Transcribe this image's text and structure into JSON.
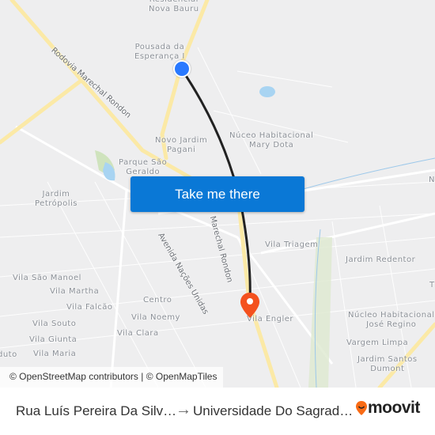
{
  "map": {
    "neighborhoods": [
      "Residencial\nNova Bauru",
      "Pousada da\nEsperança I",
      "Novo Jardim\nPagani",
      "Parque São\nGeraldo",
      "Núceo Habitacional\nMary Dota",
      "Jardim\nPetrópolis",
      "Vila Triagem",
      "Jardim Redentor",
      "Vila São Manoel",
      "Vila Martha",
      "Vila Falcão",
      "Centro",
      "Vila Noemy",
      "Vila Souto",
      "Vila Clara",
      "Vila Giunta",
      "Vila Maria",
      "Vila Engler",
      "Núcleo Habitacional\nJosé Regino",
      "Vargem Limpa",
      "Jardim Santos\nDumont",
      "duto",
      "N",
      "T"
    ],
    "roads": [
      "Rodovia Marechal Rondon",
      "Marechal Rondon",
      "Avenida Nações Unidas"
    ],
    "origin_marker_color": "#2979ff",
    "destination_marker_color": "#f4511e",
    "route_color": "#222222",
    "highway_color": "#fbe9a6",
    "attribution": "© OpenStreetMap contributors | © OpenMapTiles"
  },
  "cta": {
    "label": "Take me there",
    "color": "#0a78d6"
  },
  "footer": {
    "from": "Rua Luís Pereira Da Silv…",
    "arrow_icon": "arrow-right-icon",
    "to": "Universidade Do Sagrad…",
    "brand": "moovit",
    "brand_color": "#f96b15"
  }
}
